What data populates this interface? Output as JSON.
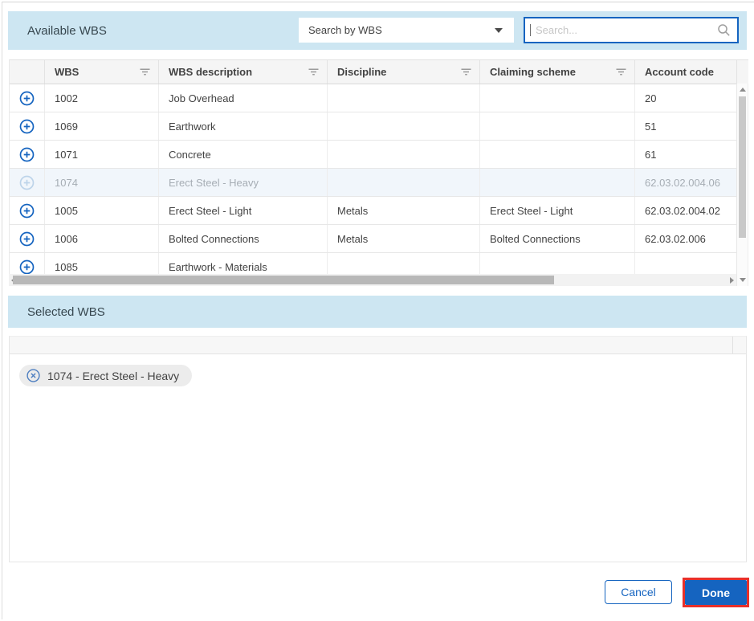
{
  "header": {
    "title": "Available WBS",
    "search_mode": "Search by WBS",
    "search_placeholder": "Search..."
  },
  "table": {
    "columns": [
      {
        "label": "",
        "filter": false
      },
      {
        "label": "WBS",
        "filter": true
      },
      {
        "label": "WBS description",
        "filter": true
      },
      {
        "label": "Discipline",
        "filter": true
      },
      {
        "label": "Claiming scheme",
        "filter": true
      },
      {
        "label": "Account code",
        "filter": false
      }
    ],
    "rows": [
      {
        "wbs": "1002",
        "description": "Job Overhead",
        "discipline": "",
        "claiming_scheme": "",
        "account_code": "20",
        "disabled": false
      },
      {
        "wbs": "1069",
        "description": "Earthwork",
        "discipline": "",
        "claiming_scheme": "",
        "account_code": "51",
        "disabled": false
      },
      {
        "wbs": "1071",
        "description": "Concrete",
        "discipline": "",
        "claiming_scheme": "",
        "account_code": "61",
        "disabled": false
      },
      {
        "wbs": "1074",
        "description": "Erect Steel - Heavy",
        "discipline": "",
        "claiming_scheme": "",
        "account_code": "62.03.02.004.06",
        "disabled": true
      },
      {
        "wbs": "1005",
        "description": "Erect Steel - Light",
        "discipline": "Metals",
        "claiming_scheme": "Erect Steel - Light",
        "account_code": "62.03.02.004.02",
        "disabled": false
      },
      {
        "wbs": "1006",
        "description": "Bolted Connections",
        "discipline": "Metals",
        "claiming_scheme": "Bolted Connections",
        "account_code": "62.03.02.006",
        "disabled": false
      },
      {
        "wbs": "1085",
        "description": "Earthwork - Materials",
        "discipline": "",
        "claiming_scheme": "",
        "account_code": "",
        "disabled": false
      }
    ]
  },
  "selected": {
    "title": "Selected WBS",
    "chips": [
      "1074 - Erect Steel - Heavy"
    ]
  },
  "footer": {
    "cancel_label": "Cancel",
    "done_label": "Done"
  },
  "icons": {
    "add": "plus-circle-icon",
    "remove": "x-circle-icon",
    "search": "magnifier-icon",
    "dropdown": "chevron-down-icon",
    "filter": "filter-lines-icon"
  },
  "colors": {
    "accent_blue": "#1564c0",
    "panel_blue": "#cde6f2",
    "highlight_red": "#e8302a",
    "header_text": "#37474f",
    "cell_text": "#424242",
    "disabled_text": "#a6adb4",
    "disabled_row_bg": "#f1f6fb",
    "chip_bg": "#ececec",
    "table_header_bg": "#f5f5f5"
  }
}
